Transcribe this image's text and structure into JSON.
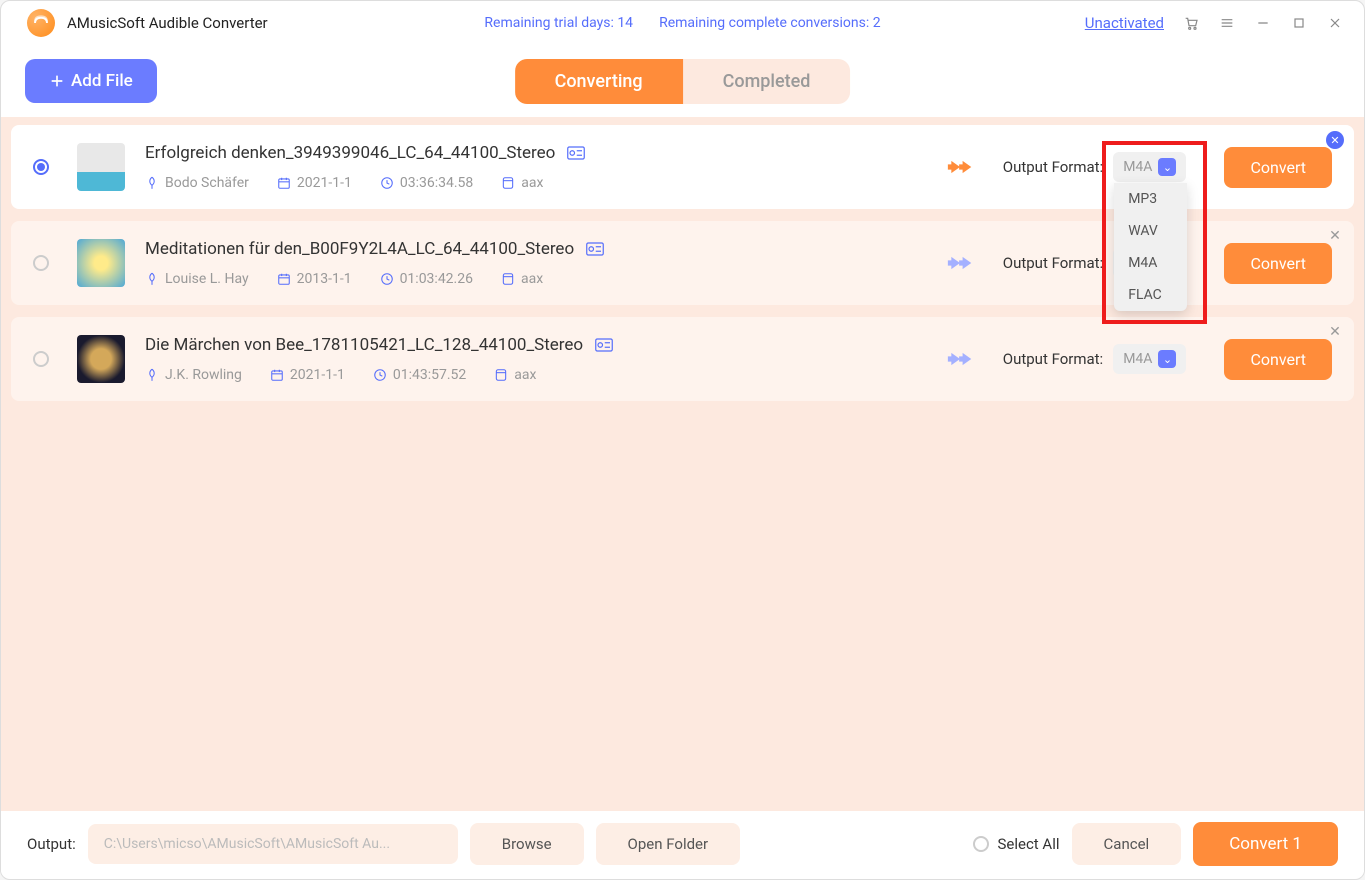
{
  "app_title": "AMusicSoft Audible Converter",
  "trial_days_label": "Remaining trial days: 14",
  "conversions_label": "Remaining complete conversions: 2",
  "unactivated_label": "Unactivated",
  "add_file_label": "Add File",
  "tabs": {
    "converting": "Converting",
    "completed": "Completed"
  },
  "output_format_label": "Output Format:",
  "convert_label": "Convert",
  "items": [
    {
      "title": "Erfolgreich denken_3949399046_LC_64_44100_Stereo",
      "author": "Bodo Schäfer",
      "date": "2021-1-1",
      "duration": "03:36:34.58",
      "ext": "aax",
      "format": "M4A",
      "selected": true
    },
    {
      "title": "Meditationen für den_B00F9Y2L4A_LC_64_44100_Stereo",
      "author": "Louise L. Hay",
      "date": "2013-1-1",
      "duration": "01:03:42.26",
      "ext": "aax",
      "format": "M4A",
      "selected": false
    },
    {
      "title": "Die Märchen von Bee_1781105421_LC_128_44100_Stereo",
      "author": "J.K. Rowling",
      "date": "2021-1-1",
      "duration": "01:43:57.52",
      "ext": "aax",
      "format": "M4A",
      "selected": false
    }
  ],
  "dropdown_options": [
    "MP3",
    "WAV",
    "M4A",
    "FLAC"
  ],
  "footer": {
    "output_label": "Output:",
    "path": "C:\\Users\\micso\\AMusicSoft\\AMusicSoft Au...",
    "browse": "Browse",
    "open_folder": "Open Folder",
    "select_all": "Select All",
    "cancel": "Cancel",
    "convert_all": "Convert 1"
  }
}
